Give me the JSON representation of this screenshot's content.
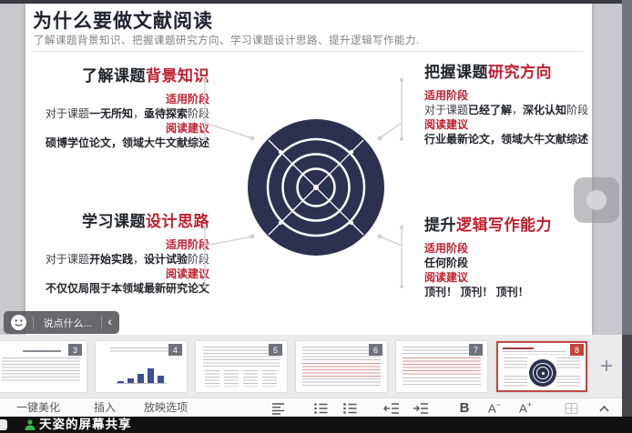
{
  "slide": {
    "title": "为什么要做文献阅读",
    "subtitle": "了解课题背景知识、把握课题研究方向、学习课题设计思路、提升逻辑写作能力.",
    "colors": {
      "accent_red": "#c01f2f",
      "dark_text": "#23242c",
      "target_navy": "#2c3150"
    },
    "quadrants": [
      {
        "title_dark": "了解课题",
        "title_red": "背景知识",
        "stage_label": "适用阶段",
        "stage_parts": {
          "pre": "对于课题",
          "bold1": "一无所知",
          "sep": "，",
          "bold2": "亟待探索",
          "post": "阶段"
        },
        "advice_label": "阅读建议",
        "advice": "硕博学位论文，领域大牛文献综述"
      },
      {
        "title_dark": "把握课题",
        "title_red": "研究方向",
        "stage_label": "适用阶段",
        "stage_parts": {
          "pre": "对于课题",
          "bold1": "已经了解",
          "sep": "，",
          "bold2": "深化认知",
          "post": "阶段"
        },
        "advice_label": "阅读建议",
        "advice": "行业最新论文，领域大牛文献综述"
      },
      {
        "title_dark": "学习课题",
        "title_red": "设计思路",
        "stage_label": "适用阶段",
        "stage_parts": {
          "pre": "对于课题",
          "bold1": "开始实践",
          "sep": "，",
          "bold2": "设计试验",
          "post": "阶段"
        },
        "advice_label": "阅读建议",
        "advice": "不仅仅局限于本领域最新研究论文"
      },
      {
        "title_dark": "提升",
        "title_red": "逻辑写作能力",
        "stage_label": "适用阶段",
        "stage_parts": {
          "pre": "",
          "bold1": "任何阶段",
          "sep": "",
          "bold2": "",
          "post": ""
        },
        "advice_label": "阅读建议",
        "advice": "顶刊！ 顶刊！ 顶刊！"
      }
    ]
  },
  "chat": {
    "placeholder": "说点什么...",
    "collapse_icon": "‹"
  },
  "thumbnails": {
    "numbers": [
      "3",
      "4",
      "5",
      "6",
      "7",
      "8"
    ],
    "selected": "8",
    "add_label": "+"
  },
  "footer": {
    "beautify": "一键美化",
    "insert": "插入",
    "play_options": "放映选项",
    "bold_label": "B",
    "font_down_label": "A",
    "font_down_sign": "−",
    "font_up_label": "A",
    "font_up_sign": "+"
  },
  "share_banner": {
    "text": "天姿的屏幕共享"
  }
}
